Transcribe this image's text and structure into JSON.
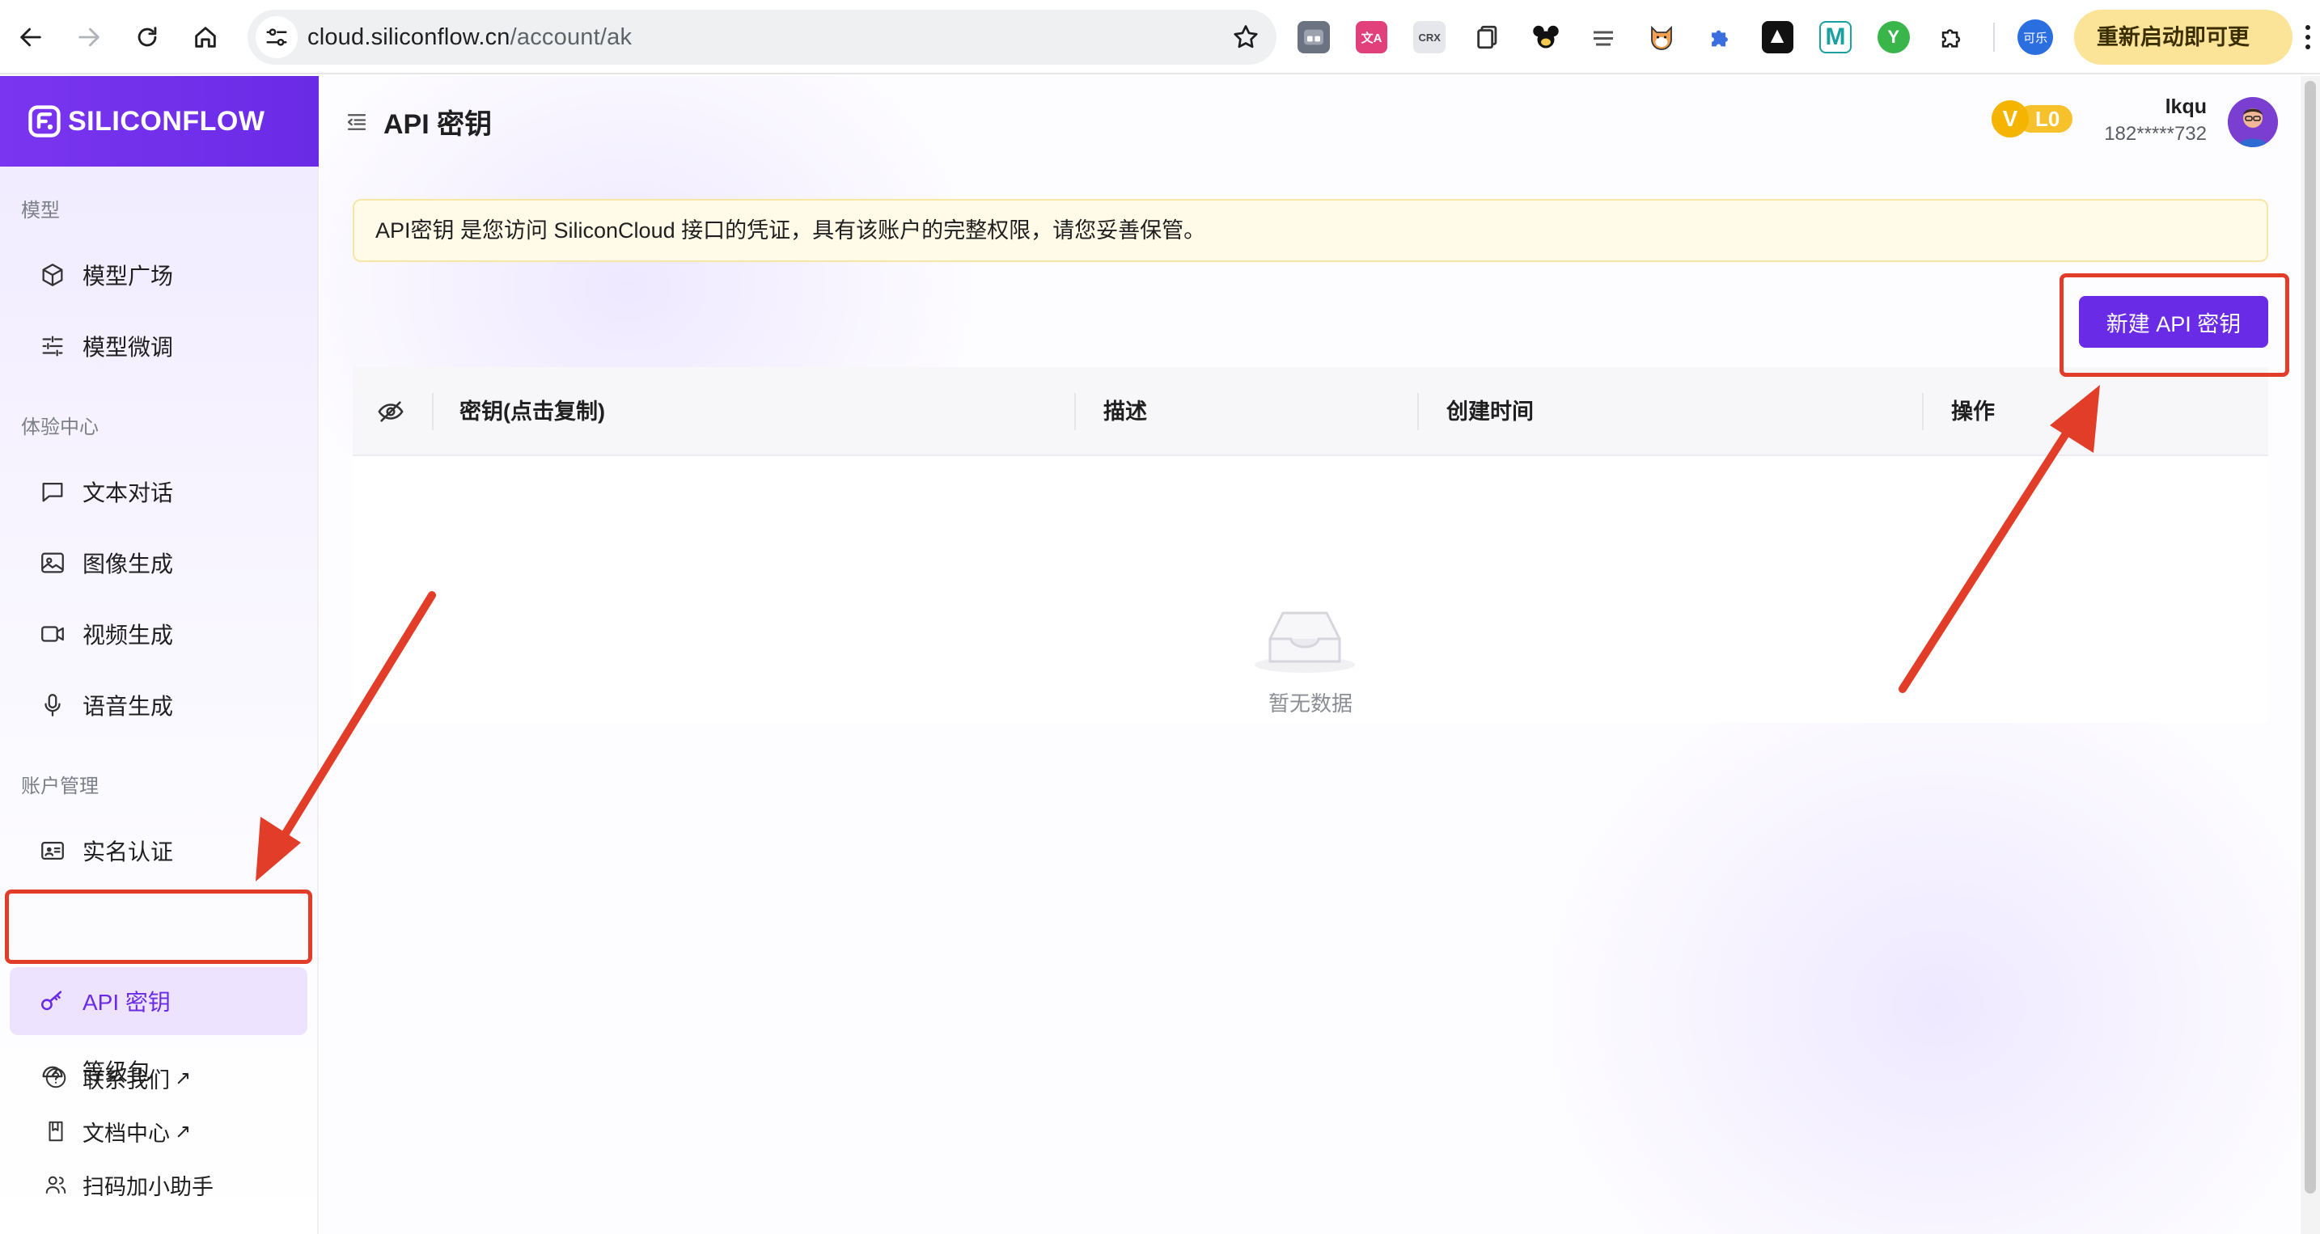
{
  "browser": {
    "url_host": "cloud.siliconflow.cn",
    "url_path": "/account/ak",
    "profile_label": "可乐",
    "update_label": "重新启动即可更新",
    "extensions": [
      "tab-manager-icon",
      "translate-extension-icon",
      "crx-extension-icon",
      "copy-extension-icon",
      "mouse-extension-icon",
      "cool-tools-extension-icon",
      "shiba-extension-icon",
      "puzzle-extension-icon",
      "shield-extension-icon",
      "m-extension-icon",
      "y-extension-icon",
      "extensions-menu-icon"
    ],
    "ext_crx": "CRX",
    "ext_ca": "文A",
    "ext_m": "M",
    "ext_y": "Y"
  },
  "brand": {
    "name": "SILICONFLOW"
  },
  "sidebar": {
    "sections": [
      {
        "label": "模型",
        "items": [
          {
            "label": "模型广场",
            "icon": "cube-icon"
          },
          {
            "label": "模型微调",
            "icon": "sliders-icon"
          }
        ]
      },
      {
        "label": "体验中心",
        "items": [
          {
            "label": "文本对话",
            "icon": "chat-icon"
          },
          {
            "label": "图像生成",
            "icon": "image-icon"
          },
          {
            "label": "视频生成",
            "icon": "video-icon"
          },
          {
            "label": "语音生成",
            "icon": "microphone-icon"
          }
        ]
      },
      {
        "label": "账户管理",
        "items": [
          {
            "label": "实名认证",
            "icon": "id-card-icon"
          },
          {
            "label": "API 密钥",
            "icon": "key-icon",
            "active": true
          },
          {
            "label": "等级包",
            "icon": "gauge-icon"
          }
        ]
      }
    ],
    "bottom_links": [
      {
        "label": "联系我们",
        "suffix": "↗",
        "icon": "help-circle-icon"
      },
      {
        "label": "文档中心",
        "suffix": "↗",
        "icon": "book-icon"
      },
      {
        "label": "扫码加小助手",
        "icon": "users-icon"
      }
    ]
  },
  "header": {
    "title": "API 密钥",
    "vip_badge": "V",
    "vip_level": "L0",
    "user_name": "lkqu",
    "user_phone": "182*****732"
  },
  "notice": "API密钥 是您访问 SiliconCloud 接口的凭证，具有该账户的完整权限，请您妥善保管。",
  "new_key_button": "新建 API 密钥",
  "table": {
    "columns": [
      "密钥(点击复制)",
      "描述",
      "创建时间",
      "操作"
    ],
    "rows": [],
    "empty_text": "暂无数据"
  },
  "colors": {
    "brand": "#6a2be6",
    "annotation": "#e23d28",
    "notice_bg": "#fffbe8",
    "vip": "#f5b400"
  }
}
